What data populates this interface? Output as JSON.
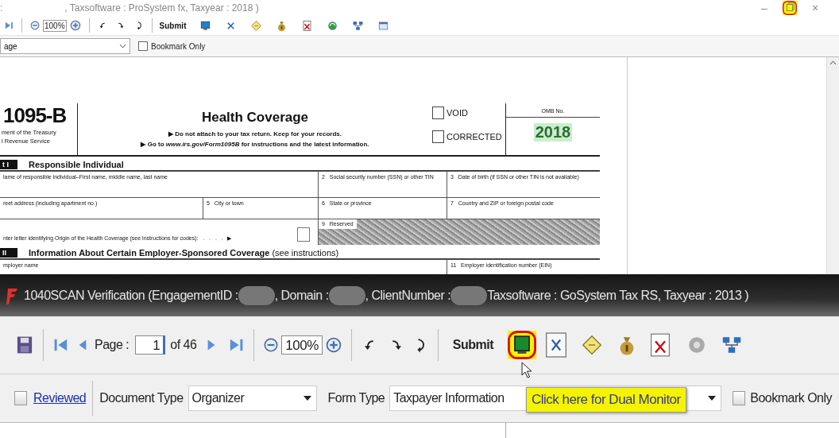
{
  "background_window": {
    "title_start": ":",
    "title_end": ", Taxsoftware : ProSystem fx, Taxyear : 2018 )",
    "window_controls": [
      {
        "kind": "minimize",
        "text": "–",
        "highlighted": false
      },
      {
        "kind": "restore",
        "highlighted": true
      },
      {
        "kind": "close",
        "text": "×",
        "highlighted": false
      }
    ],
    "toolbar": {
      "zoom": "100%",
      "submit": "Submit"
    },
    "page_select": "age",
    "bookmark_only": {
      "label": "Bookmark Only",
      "checked": false
    }
  },
  "form": {
    "form_number": "1095-B",
    "agency_lines": [
      "ment of the Treasury",
      "l Revenue Service"
    ],
    "title": "Health Coverage",
    "instructions": [
      "▶ Do not attach to your tax return. Keep for your records.",
      "▶ Go to *www.irs.gov/Form1095B* for instructions and the latest information."
    ],
    "checkboxes": [
      {
        "label": "VOID",
        "checked": false
      },
      {
        "label": "CORRECTED",
        "checked": false
      }
    ],
    "omb_label": "OMB No.",
    "year": "2018",
    "parts": [
      {
        "tag": "t I",
        "title": "Responsible Individual",
        "fields": [
          {
            "kind": "field",
            "label": "lame of responsible individual–First name, middle name, last name"
          },
          {
            "kind": "field",
            "number": "2",
            "label": "Social security number (SSN) or other TIN"
          },
          {
            "kind": "field",
            "number": "3",
            "label": "Date of birth (if SSN or other TIN is not available)"
          },
          {
            "kind": "field",
            "label": "reet address (including apartment no.)"
          },
          {
            "kind": "field",
            "number": "5",
            "label": "City or town"
          },
          {
            "kind": "field",
            "number": "6",
            "label": "State or province"
          },
          {
            "kind": "field",
            "number": "7",
            "label": "Country and ZIP or foreign postal code"
          },
          {
            "kind": "code_box",
            "label": "nter letter identifying Origin of the Health Coverage (see instructions for codes):   .   .   .   .   ▶"
          },
          {
            "kind": "shaded",
            "number": "9",
            "label": "Reserved"
          }
        ]
      },
      {
        "tag": "II",
        "title": "**Information About Certain Employer-Sponsored Coverage** (see instructions)",
        "fields": [
          {
            "kind": "field",
            "label": "mployer name"
          },
          {
            "kind": "field",
            "number": "11",
            "label": "Employer identification number (EIN)"
          }
        ]
      }
    ]
  },
  "foreground_window": {
    "title_parts": [
      "1040SCAN Verification (EngagementID :",
      ", Domain :",
      ", ClientNumber :",
      "Taxsoftware : GoSystem Tax RS, Taxyear : 2013 )"
    ],
    "toolbar": {
      "page_label": "Page :",
      "page_value": "1",
      "page_total": "of 46",
      "zoom": "100%",
      "submit": "Submit",
      "dual_monitor": {
        "highlighted": true
      }
    },
    "options": {
      "reviewed": {
        "label": "Reviewed",
        "checked": false
      },
      "document_type": {
        "label": "Document Type",
        "value": "Organizer"
      },
      "form_type": {
        "label": "Form Type",
        "value": "Taxpayer Information"
      },
      "tooltip": "Click here for Dual Monitor",
      "bookmark_only": {
        "label": "Bookmark Only",
        "checked": false
      }
    }
  }
}
